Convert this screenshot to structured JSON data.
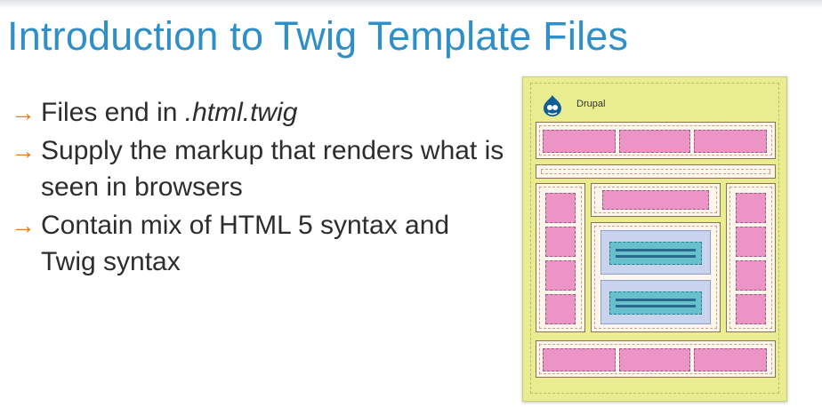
{
  "slide": {
    "title": "Introduction to Twig Template Files",
    "bullets": [
      {
        "plain": "Files end in ",
        "em": ".html.twig"
      },
      {
        "plain": "Supply the markup that renders what is seen in browsers",
        "em": ""
      },
      {
        "plain": "Contain mix of HTML 5 syntax and Twig syntax",
        "em": ""
      }
    ],
    "bullet_glyph": "→"
  },
  "illustration": {
    "brand": "Drupal",
    "logo_icon": "drupal-drop-icon"
  },
  "colors": {
    "title": "#2f8fc6",
    "arrow": "#e57d16",
    "page_background": "#e9ed8f",
    "region": "#ec94c5",
    "content": "#c9d3ee",
    "block": "#66c1cc"
  }
}
